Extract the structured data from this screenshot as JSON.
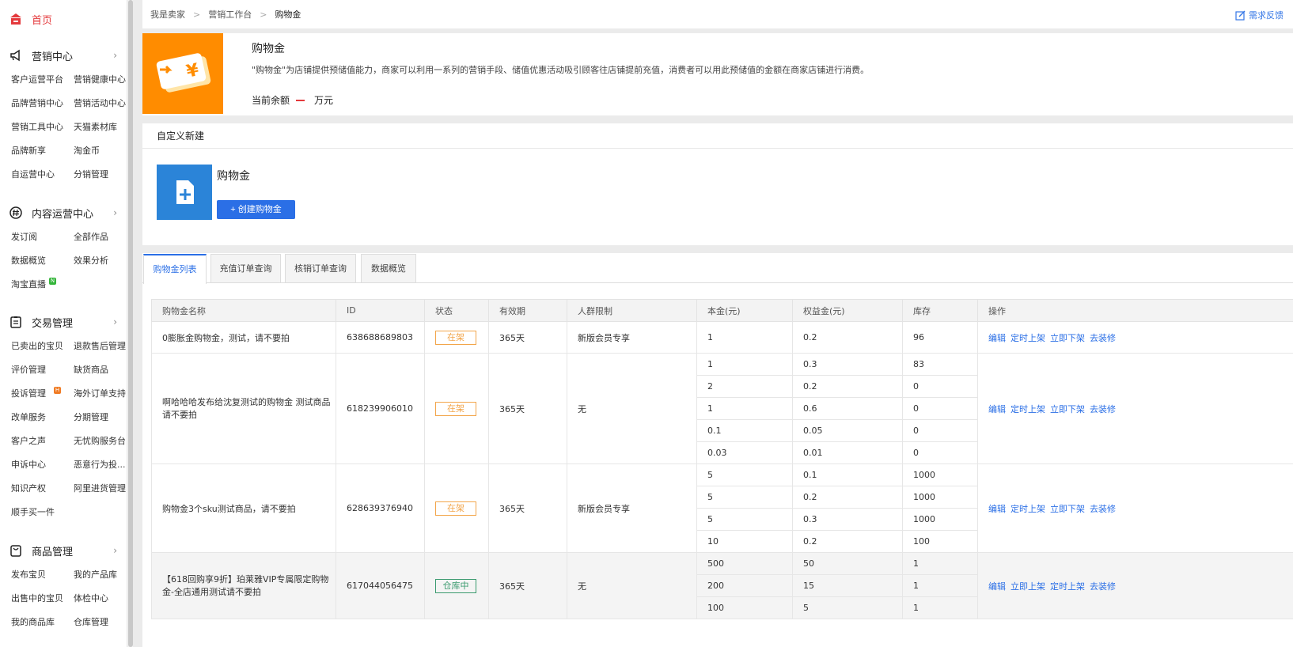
{
  "sidebar": {
    "home": "首页",
    "sections": [
      {
        "title": "营销中心",
        "items": [
          "客户运营平台",
          "营销健康中心",
          "品牌营销中心",
          "营销活动中心",
          "营销工具中心",
          "天猫素材库",
          "品牌新享",
          "淘金币",
          "自运营中心",
          "分销管理"
        ]
      },
      {
        "title": "内容运营中心",
        "items": [
          "发订阅",
          "全部作品",
          "数据概览",
          "效果分析",
          "淘宝直播"
        ],
        "badge": "N"
      },
      {
        "title": "交易管理",
        "items": [
          "已卖出的宝贝",
          "退款售后管理",
          "评价管理",
          "缺货商品",
          "投诉管理",
          "海外订单支持",
          "改单服务",
          "分期管理",
          "客户之声",
          "无忧购服务台",
          "申诉中心",
          "恶意行为投...",
          "知识产权",
          "阿里进货管理",
          "顺手买一件"
        ],
        "badge": "H"
      },
      {
        "title": "商品管理",
        "items": [
          "发布宝贝",
          "我的产品库",
          "出售中的宝贝",
          "体检中心",
          "我的商品库",
          "仓库管理"
        ]
      }
    ],
    "chevron": "›"
  },
  "breadcrumb": [
    "我是卖家",
    "营销工作台",
    "购物金"
  ],
  "breadcrumb_sep": ">",
  "feedback": "需求反馈",
  "intro": {
    "title": "购物金",
    "desc": "\"购物金\"为店铺提供预储值能力，商家可以利用一系列的营销手段、储值优惠活动吸引顾客往店铺提前充值，消费者可以用此预储值的金额在商家店铺进行消费。",
    "balance_label": "当前余额",
    "balance_unit": "万元"
  },
  "custom": {
    "head": "自定义新建",
    "card_title": "购物金",
    "create_button": "+ 创建购物金"
  },
  "tabs": [
    "购物金列表",
    "充值订单查询",
    "核销订单查询",
    "数据概览"
  ],
  "table": {
    "headers": [
      "购物金名称",
      "ID",
      "状态",
      "有效期",
      "人群限制",
      "本金(元)",
      "权益金(元)",
      "库存",
      "操作"
    ],
    "rows": [
      {
        "name": "0膨胀金购物金，测试，请不要拍",
        "id": "638688689803",
        "status": "在架",
        "validity": "365天",
        "crowd": "新版会员专享",
        "skus": [
          [
            "1",
            "0.2",
            "96"
          ]
        ],
        "ops": [
          "编辑",
          "定时上架",
          "立即下架",
          "去装修"
        ]
      },
      {
        "name": "啊哈哈哈发布给沈复测试的购物金 测试商品请不要拍",
        "id": "618239906010",
        "status": "在架",
        "validity": "365天",
        "crowd": "无",
        "skus": [
          [
            "1",
            "0.3",
            "83"
          ],
          [
            "2",
            "0.2",
            "0"
          ],
          [
            "1",
            "0.6",
            "0"
          ],
          [
            "0.1",
            "0.05",
            "0"
          ],
          [
            "0.03",
            "0.01",
            "0"
          ]
        ],
        "ops": [
          "编辑",
          "定时上架",
          "立即下架",
          "去装修"
        ]
      },
      {
        "name": "购物金3个sku测试商品，请不要拍",
        "id": "628639376940",
        "status": "在架",
        "validity": "365天",
        "crowd": "新版会员专享",
        "skus": [
          [
            "5",
            "0.1",
            "1000"
          ],
          [
            "5",
            "0.2",
            "1000"
          ],
          [
            "5",
            "0.3",
            "1000"
          ],
          [
            "10",
            "0.2",
            "100"
          ]
        ],
        "ops": [
          "编辑",
          "定时上架",
          "立即下架",
          "去装修"
        ]
      },
      {
        "name": "【618回购享9折】珀莱雅VIP专属限定购物金-全店通用测试请不要拍",
        "id": "617044056475",
        "status": "仓库中",
        "validity": "365天",
        "crowd": "无",
        "skus": [
          [
            "500",
            "50",
            "1"
          ],
          [
            "200",
            "15",
            "1"
          ],
          [
            "100",
            "5",
            "1"
          ]
        ],
        "ops": [
          "编辑",
          "立即上架",
          "定时上架",
          "去装修"
        ]
      }
    ]
  },
  "colors": {
    "accent": "#2b6fe6",
    "brand_red": "#e4393c",
    "orange": "#ff8c00",
    "status_on": "#f2a54a",
    "status_wh": "#3a9a6e"
  },
  "icons": {
    "home": "shop-icon",
    "marketing": "megaphone-icon",
    "content": "hashtag-icon",
    "trade": "clipboard-icon",
    "goods": "bag-icon",
    "feedback": "edit-icon"
  }
}
